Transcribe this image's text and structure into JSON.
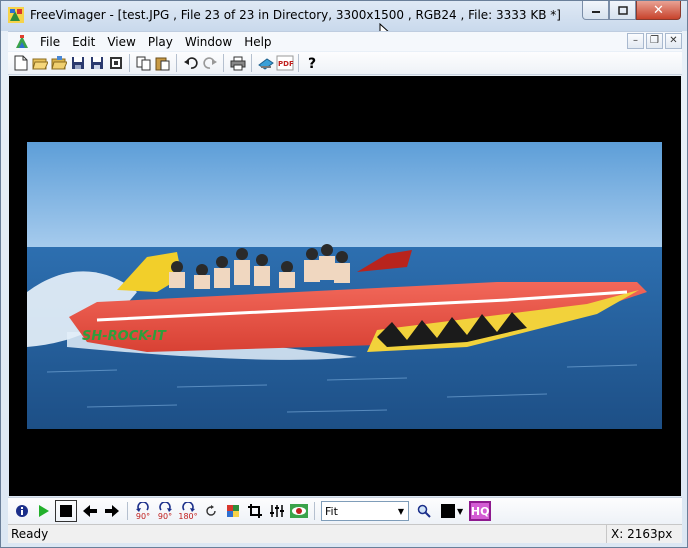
{
  "window": {
    "title": "FreeVimager - [test.JPG , File 23 of 23 in Directory, 3300x1500 , RGB24 , File: 3333 KB *]"
  },
  "menu": {
    "items": [
      "File",
      "Edit",
      "View",
      "Play",
      "Window",
      "Help"
    ]
  },
  "toolbar": {
    "icons": [
      "new-file-icon",
      "open-icon",
      "open-folder-icon",
      "save-icon",
      "save-as-icon",
      "save-copy-icon",
      "copy-icon",
      "paste-icon",
      "undo-icon",
      "redo-icon",
      "print-icon",
      "scan-icon",
      "pdf-icon",
      "help-icon"
    ]
  },
  "bottom_toolbar": {
    "zoom_value": "Fit",
    "hq_label": "HQ",
    "rotate_labels": [
      "90°",
      "90°",
      "180°"
    ]
  },
  "status": {
    "left": "Ready",
    "right": "X: 2163px"
  },
  "colors": {
    "sky": "#6fa9da",
    "sea": "#2e6aa6",
    "boat": "#e6553d"
  }
}
